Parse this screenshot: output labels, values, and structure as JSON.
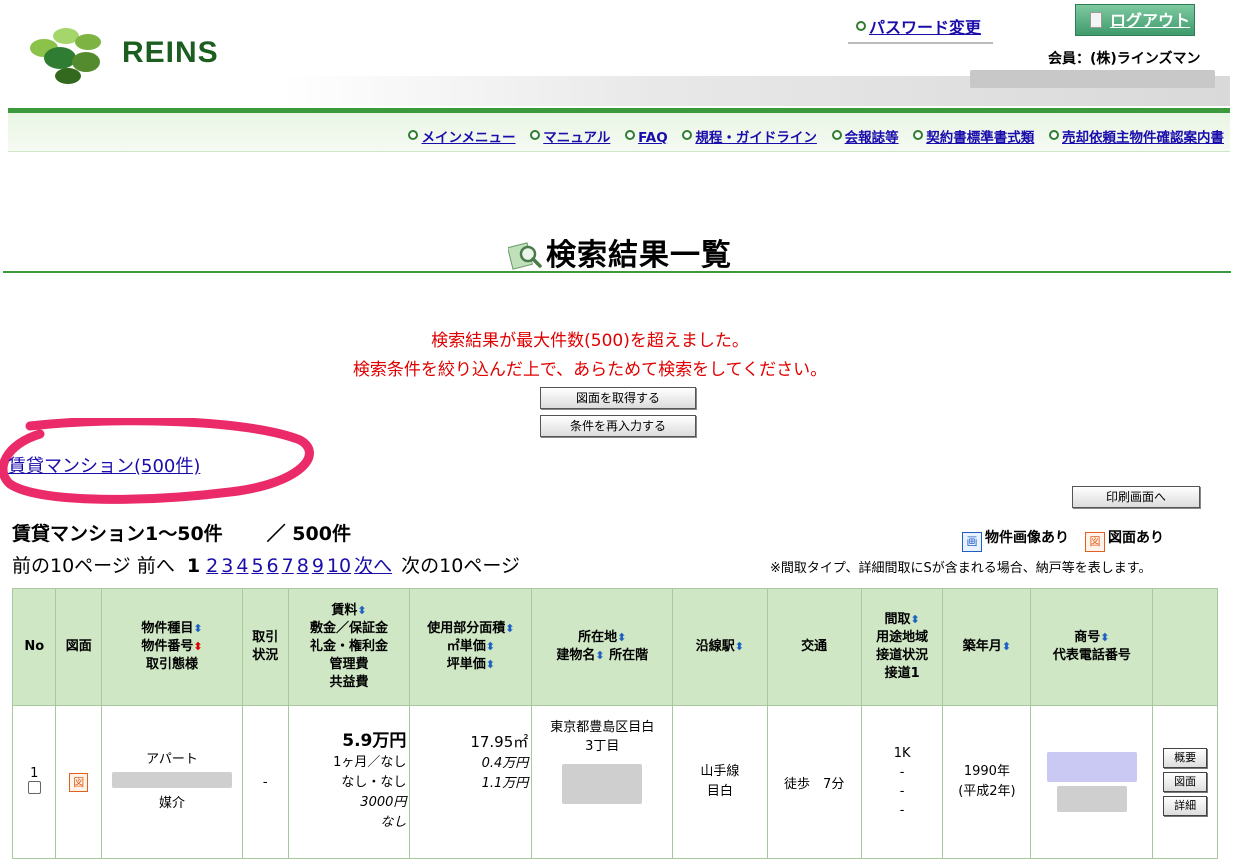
{
  "header": {
    "logo_text": "REINS",
    "password_link": "パスワード変更",
    "logout_label": "ログアウト",
    "member": "会員：(株)ラインズマン"
  },
  "nav": [
    "メインメニュー",
    "マニュアル",
    "FAQ",
    "規程・ガイドライン",
    "会報誌等",
    "契約書標準書式類",
    "売却依頼主物件確認案内書"
  ],
  "page_title": "検索結果一覧",
  "warning": {
    "line1": "検索結果が最大件数(500)を超えました。",
    "line2": "検索条件を絞り込んだ上で、あらためて検索をしてください。"
  },
  "buttons": {
    "get_figures": "図面を取得する",
    "reenter": "条件を再入力する",
    "print": "印刷画面へ"
  },
  "result_link": "賃貸マンション(500件)",
  "range": {
    "label": "賃貸マンション1～50件",
    "total": "／ 500件"
  },
  "pager": {
    "prev10": "前の10ページ",
    "prev": "前へ",
    "current": "1",
    "pages": [
      "2",
      "3",
      "4",
      "5",
      "6",
      "7",
      "8",
      "9",
      "10"
    ],
    "next": "次へ",
    "next10": "次の10ページ"
  },
  "legend": {
    "image_icon": "画",
    "image_label": "物件画像あり",
    "figure_icon": "図",
    "figure_label": "図面あり",
    "note": "※間取タイプ、詳細間取にSが含まれる場合、納戸等を表します。"
  },
  "table": {
    "headers": {
      "no": "No",
      "figure": "図面",
      "type": [
        "物件種目",
        "物件番号",
        "取引態様"
      ],
      "status": [
        "取引",
        "状況"
      ],
      "fee": [
        "賃料",
        "敷金／保証金",
        "礼金・権利金",
        "管理費",
        "共益費"
      ],
      "area": [
        "使用部分面積",
        "㎡単価",
        "坪単価"
      ],
      "location": [
        "所在地",
        "建物名",
        "所在階"
      ],
      "station": "沿線駅",
      "transport": "交通",
      "layout": [
        "間取",
        "用途地域",
        "接道状況",
        "接道1"
      ],
      "built": "築年月",
      "company": [
        "商号",
        "代表電話番号"
      ]
    },
    "row": {
      "no": "1",
      "figure_icon": "図",
      "type": "アパート",
      "deal": "媒介",
      "status": "-",
      "rent": "5.9万円",
      "deposit": "1ヶ月／なし",
      "key_money": "なし・なし",
      "management": "3000円",
      "common": "なし",
      "area": "17.95㎡",
      "sqm_price": "0.4万円",
      "tsubo_price": "1.1万円",
      "address1": "東京都豊島区目白",
      "address2": "3丁目",
      "line": "山手線",
      "station": "目白",
      "transport": "徒歩　7分",
      "layout": "1K",
      "zone": "-",
      "road": "-",
      "road1": "-",
      "built_year": "1990年",
      "built_era": "(平成2年)",
      "btn_summary": "概要",
      "btn_figure": "図面",
      "btn_detail": "詳細"
    }
  },
  "sort_icon": "⬍"
}
